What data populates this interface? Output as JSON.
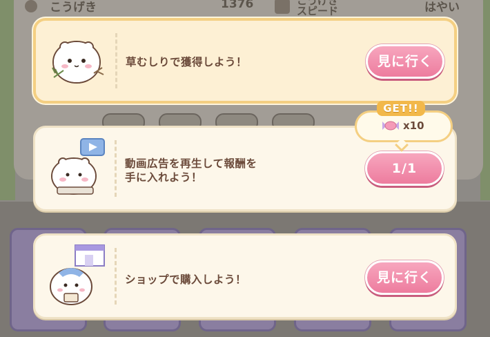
{
  "background": {
    "stats": {
      "label1": "こうげき",
      "value1": "1376",
      "label2": "こうげき\nスピード",
      "value2": "はやい"
    }
  },
  "missions": [
    {
      "text": "草むしりで獲得しよう！",
      "button_label": "見に行く",
      "avatar": "chiikawa-weeding-icon"
    },
    {
      "text": "動画広告を再生して報酬を\n手に入れよう！",
      "button_label": "1/1",
      "avatar": "chiikawa-video-icon"
    },
    {
      "text": "ショップで購入しよう！",
      "button_label": "見に行く",
      "avatar": "hachiware-shop-icon"
    }
  ],
  "reward": {
    "get_label": "GET!!",
    "count": "x10",
    "icon": "candy-icon"
  },
  "colors": {
    "accent_pink": "#ed7c9e",
    "card_bg": "#fdf7ea",
    "highlight_border": "#f4cf82",
    "text_brown": "#6b4a3a"
  }
}
